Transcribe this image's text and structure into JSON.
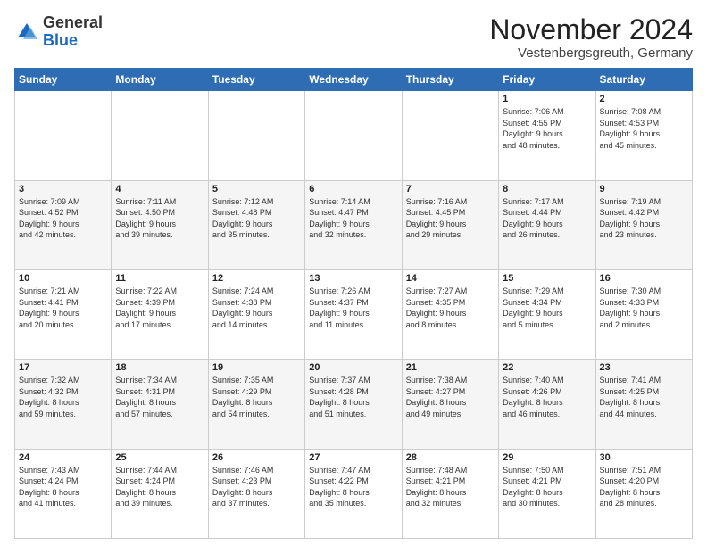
{
  "header": {
    "logo": {
      "general": "General",
      "blue": "Blue"
    },
    "title": "November 2024",
    "location": "Vestenbergsgreuth, Germany"
  },
  "days_of_week": [
    "Sunday",
    "Monday",
    "Tuesday",
    "Wednesday",
    "Thursday",
    "Friday",
    "Saturday"
  ],
  "weeks": [
    [
      {
        "day": "",
        "info": ""
      },
      {
        "day": "",
        "info": ""
      },
      {
        "day": "",
        "info": ""
      },
      {
        "day": "",
        "info": ""
      },
      {
        "day": "",
        "info": ""
      },
      {
        "day": "1",
        "info": "Sunrise: 7:06 AM\nSunset: 4:55 PM\nDaylight: 9 hours\nand 48 minutes."
      },
      {
        "day": "2",
        "info": "Sunrise: 7:08 AM\nSunset: 4:53 PM\nDaylight: 9 hours\nand 45 minutes."
      }
    ],
    [
      {
        "day": "3",
        "info": "Sunrise: 7:09 AM\nSunset: 4:52 PM\nDaylight: 9 hours\nand 42 minutes."
      },
      {
        "day": "4",
        "info": "Sunrise: 7:11 AM\nSunset: 4:50 PM\nDaylight: 9 hours\nand 39 minutes."
      },
      {
        "day": "5",
        "info": "Sunrise: 7:12 AM\nSunset: 4:48 PM\nDaylight: 9 hours\nand 35 minutes."
      },
      {
        "day": "6",
        "info": "Sunrise: 7:14 AM\nSunset: 4:47 PM\nDaylight: 9 hours\nand 32 minutes."
      },
      {
        "day": "7",
        "info": "Sunrise: 7:16 AM\nSunset: 4:45 PM\nDaylight: 9 hours\nand 29 minutes."
      },
      {
        "day": "8",
        "info": "Sunrise: 7:17 AM\nSunset: 4:44 PM\nDaylight: 9 hours\nand 26 minutes."
      },
      {
        "day": "9",
        "info": "Sunrise: 7:19 AM\nSunset: 4:42 PM\nDaylight: 9 hours\nand 23 minutes."
      }
    ],
    [
      {
        "day": "10",
        "info": "Sunrise: 7:21 AM\nSunset: 4:41 PM\nDaylight: 9 hours\nand 20 minutes."
      },
      {
        "day": "11",
        "info": "Sunrise: 7:22 AM\nSunset: 4:39 PM\nDaylight: 9 hours\nand 17 minutes."
      },
      {
        "day": "12",
        "info": "Sunrise: 7:24 AM\nSunset: 4:38 PM\nDaylight: 9 hours\nand 14 minutes."
      },
      {
        "day": "13",
        "info": "Sunrise: 7:26 AM\nSunset: 4:37 PM\nDaylight: 9 hours\nand 11 minutes."
      },
      {
        "day": "14",
        "info": "Sunrise: 7:27 AM\nSunset: 4:35 PM\nDaylight: 9 hours\nand 8 minutes."
      },
      {
        "day": "15",
        "info": "Sunrise: 7:29 AM\nSunset: 4:34 PM\nDaylight: 9 hours\nand 5 minutes."
      },
      {
        "day": "16",
        "info": "Sunrise: 7:30 AM\nSunset: 4:33 PM\nDaylight: 9 hours\nand 2 minutes."
      }
    ],
    [
      {
        "day": "17",
        "info": "Sunrise: 7:32 AM\nSunset: 4:32 PM\nDaylight: 8 hours\nand 59 minutes."
      },
      {
        "day": "18",
        "info": "Sunrise: 7:34 AM\nSunset: 4:31 PM\nDaylight: 8 hours\nand 57 minutes."
      },
      {
        "day": "19",
        "info": "Sunrise: 7:35 AM\nSunset: 4:29 PM\nDaylight: 8 hours\nand 54 minutes."
      },
      {
        "day": "20",
        "info": "Sunrise: 7:37 AM\nSunset: 4:28 PM\nDaylight: 8 hours\nand 51 minutes."
      },
      {
        "day": "21",
        "info": "Sunrise: 7:38 AM\nSunset: 4:27 PM\nDaylight: 8 hours\nand 49 minutes."
      },
      {
        "day": "22",
        "info": "Sunrise: 7:40 AM\nSunset: 4:26 PM\nDaylight: 8 hours\nand 46 minutes."
      },
      {
        "day": "23",
        "info": "Sunrise: 7:41 AM\nSunset: 4:25 PM\nDaylight: 8 hours\nand 44 minutes."
      }
    ],
    [
      {
        "day": "24",
        "info": "Sunrise: 7:43 AM\nSunset: 4:24 PM\nDaylight: 8 hours\nand 41 minutes."
      },
      {
        "day": "25",
        "info": "Sunrise: 7:44 AM\nSunset: 4:24 PM\nDaylight: 8 hours\nand 39 minutes."
      },
      {
        "day": "26",
        "info": "Sunrise: 7:46 AM\nSunset: 4:23 PM\nDaylight: 8 hours\nand 37 minutes."
      },
      {
        "day": "27",
        "info": "Sunrise: 7:47 AM\nSunset: 4:22 PM\nDaylight: 8 hours\nand 35 minutes."
      },
      {
        "day": "28",
        "info": "Sunrise: 7:48 AM\nSunset: 4:21 PM\nDaylight: 8 hours\nand 32 minutes."
      },
      {
        "day": "29",
        "info": "Sunrise: 7:50 AM\nSunset: 4:21 PM\nDaylight: 8 hours\nand 30 minutes."
      },
      {
        "day": "30",
        "info": "Sunrise: 7:51 AM\nSunset: 4:20 PM\nDaylight: 8 hours\nand 28 minutes."
      }
    ]
  ]
}
